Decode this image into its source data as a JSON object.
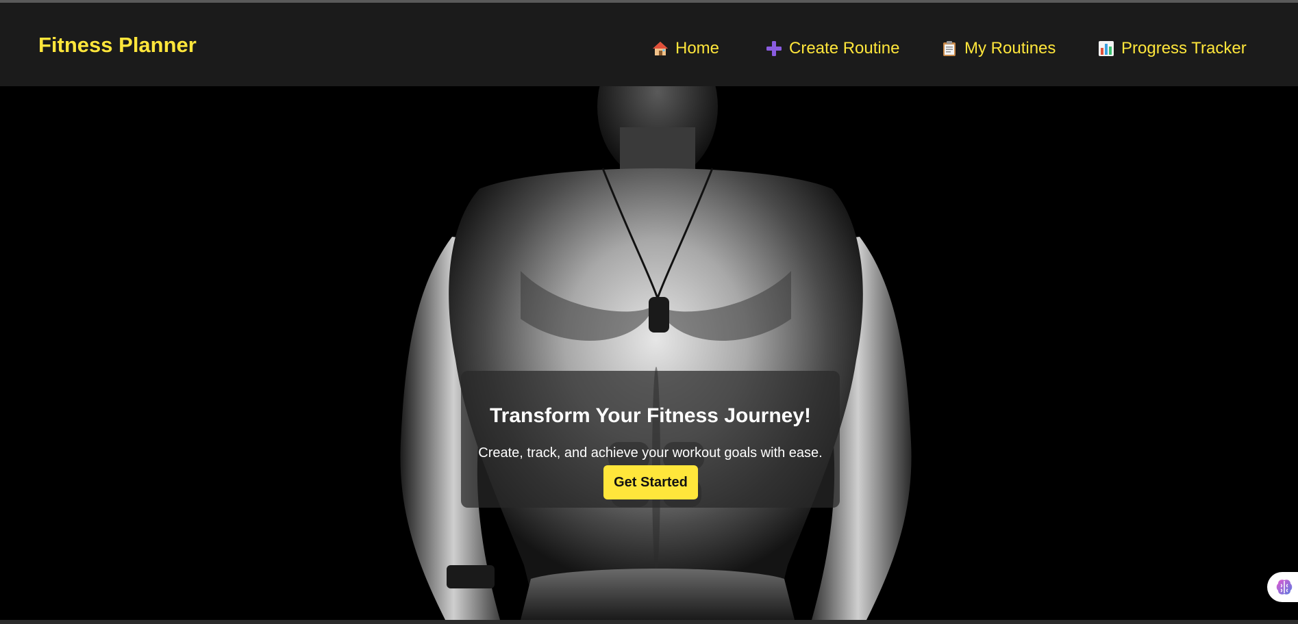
{
  "app": {
    "brand": "Fitness Planner"
  },
  "nav": {
    "home": {
      "icon": "house-icon",
      "label": "Home"
    },
    "create": {
      "icon": "plus-icon",
      "label": "Create Routine"
    },
    "routines": {
      "icon": "clipboard-icon",
      "label": "My Routines"
    },
    "progress": {
      "icon": "bar-chart-icon",
      "label": "Progress Tracker"
    }
  },
  "hero": {
    "title": "Transform Your Fitness Journey!",
    "subtitle": "Create, track, and achieve your workout goals with ease.",
    "cta_label": "Get Started",
    "image": "muscular-man-photo"
  },
  "colors": {
    "accent": "#ffe63b",
    "navbar_bg": "#1b1b1b",
    "page_bg": "#000000",
    "card_bg": "rgba(40,40,40,0.72)"
  },
  "widgets": {
    "assistant_icon": "brain-icon"
  }
}
